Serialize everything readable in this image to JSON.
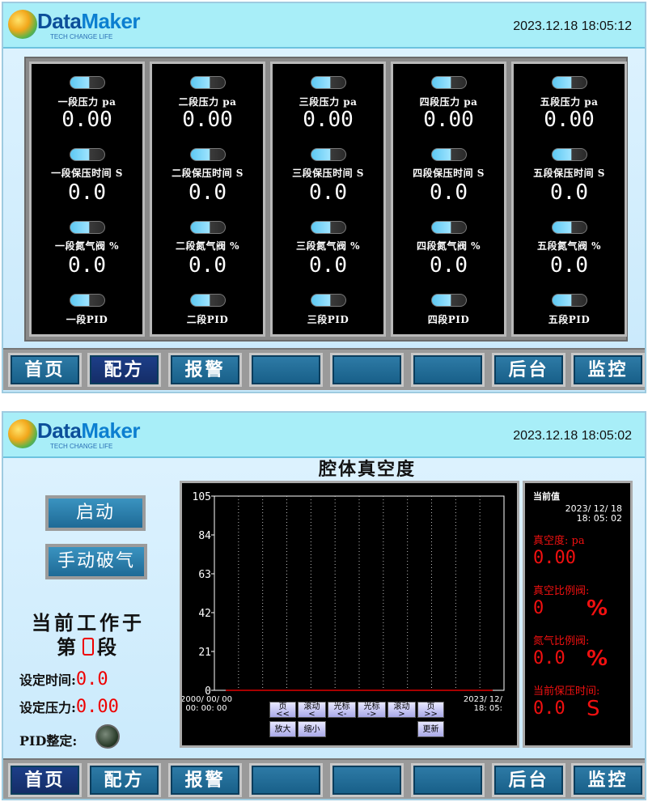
{
  "screen1": {
    "logo": {
      "word1": "Data",
      "word2": "Maker",
      "tagline": "TECH CHANGE LIFE"
    },
    "datetime": "2023.12.18   18:05:12",
    "panels": [
      {
        "pressure_label": "一段压力 pa",
        "pressure": "0.00",
        "hold_label": "一段保压时间 S",
        "hold": "0.0",
        "valve_label": "一段氮气阀 %",
        "valve": "0.0",
        "pid_label": "一段PID"
      },
      {
        "pressure_label": "二段压力 pa",
        "pressure": "0.00",
        "hold_label": "二段保压时间 S",
        "hold": "0.0",
        "valve_label": "二段氮气阀 %",
        "valve": "0.0",
        "pid_label": "二段PID"
      },
      {
        "pressure_label": "三段压力 pa",
        "pressure": "0.00",
        "hold_label": "三段保压时间 S",
        "hold": "0.0",
        "valve_label": "三段氮气阀 %",
        "valve": "0.0",
        "pid_label": "三段PID"
      },
      {
        "pressure_label": "四段压力 pa",
        "pressure": "0.00",
        "hold_label": "四段保压时间 S",
        "hold": "0.0",
        "valve_label": "四段氮气阀 %",
        "valve": "0.0",
        "pid_label": "四段PID"
      },
      {
        "pressure_label": "五段压力 pa",
        "pressure": "0.00",
        "hold_label": "五段保压时间 S",
        "hold": "0.0",
        "valve_label": "五段氮气阀 %",
        "valve": "0.0",
        "pid_label": "五段PID"
      }
    ],
    "nav": [
      "首页",
      "配方",
      "报警",
      "",
      "",
      "",
      "后台",
      "监控"
    ]
  },
  "screen2": {
    "logo": {
      "word1": "Data",
      "word2": "Maker",
      "tagline": "TECH CHANGE LIFE"
    },
    "datetime": "2023.12.18   18:05:02",
    "title": "腔体真空度",
    "start_button": "启动",
    "manual_break_button": "手动破气",
    "working_line1": "当前工作于",
    "working_line2_a": "第",
    "working_line2_b": "段",
    "set_time_label": "设定时间:",
    "set_time_value": "0.0",
    "set_pressure_label": "设定压力:",
    "set_pressure_value": "0.00",
    "pid_tune_label": "PID整定:",
    "chart_controls": {
      "page_prev": "页\n<<",
      "scroll_left": "滚动\n<",
      "cursor_left": "光标\n<-",
      "cursor_right": "光标\n->",
      "scroll_right": "滚动\n>",
      "page_next": "页\n>>",
      "zoom_in": "放大",
      "zoom_out": "缩小",
      "refresh": "更新"
    },
    "x_start": "2000/ 00/ 00\n00: 00: 00",
    "x_end": "2023/ 12/\n18: 05:",
    "side": {
      "current_label": "当前值",
      "current_time": "2023/ 12/ 18\n18: 05: 02",
      "vacuum_label": "真空度: pa",
      "vacuum_value": "0.00",
      "vac_valve_label": "真空比例阀:",
      "vac_valve_value": "0",
      "vac_valve_unit": "%",
      "n2_valve_label": "氮气比例阀:",
      "n2_valve_value": "0.0",
      "n2_valve_unit": "%",
      "hold_label": "当前保压时间:",
      "hold_value": "0.0",
      "hold_unit": "S"
    },
    "nav": [
      "首页",
      "配方",
      "报警",
      "",
      "",
      "",
      "后台",
      "监控"
    ]
  },
  "chart_data": {
    "type": "line",
    "title": "腔体真空度",
    "yticks": [
      0,
      21,
      42,
      63,
      84,
      105
    ],
    "ylim": [
      0,
      105
    ],
    "x_start_label": "2000/ 00/ 00 00: 00: 00",
    "x_end_label": "2023/ 12/ 18: 05:",
    "series": [
      {
        "values": [
          0,
          0,
          0,
          0,
          0,
          0,
          0,
          0,
          0,
          0,
          0,
          0
        ],
        "color": "#e00000"
      }
    ],
    "grid": "vertical dotted",
    "background": "#000000"
  }
}
